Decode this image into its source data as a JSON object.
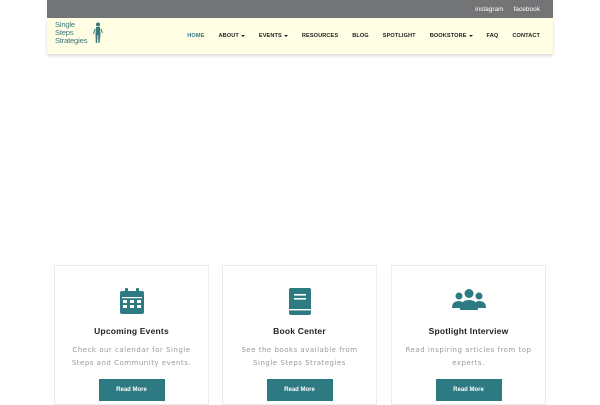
{
  "topbar": {
    "links": [
      "instagram",
      "facebook"
    ]
  },
  "logo": {
    "line1": "Single",
    "line2": "Steps",
    "line3": "Strategies",
    "icon": "walking-figures-icon"
  },
  "nav": {
    "items": [
      {
        "label": "HOME",
        "active": true,
        "dropdown": false
      },
      {
        "label": "ABOUT",
        "active": false,
        "dropdown": true
      },
      {
        "label": "EVENTS",
        "active": false,
        "dropdown": true
      },
      {
        "label": "RESOURCES",
        "active": false,
        "dropdown": false
      },
      {
        "label": "BLOG",
        "active": false,
        "dropdown": false
      },
      {
        "label": "SPOTLIGHT",
        "active": false,
        "dropdown": false
      },
      {
        "label": "BOOKSTORE",
        "active": false,
        "dropdown": true
      },
      {
        "label": "FAQ",
        "active": false,
        "dropdown": false
      },
      {
        "label": "CONTACT",
        "active": false,
        "dropdown": false
      }
    ]
  },
  "cards": [
    {
      "icon": "calendar-icon",
      "title": "Upcoming Events",
      "desc": "Check our calendar for Single Steps and Community events.",
      "button": "Read More"
    },
    {
      "icon": "book-icon",
      "title": "Book Center",
      "desc": "See the books available from Single Steps Strategies",
      "button": "Read More"
    },
    {
      "icon": "users-icon",
      "title": "Spotlight Interview",
      "desc": "Read inspiring articles from top experts.",
      "button": "Read More"
    }
  ],
  "colors": {
    "accent": "#2e7a83",
    "topbar": "#737476",
    "navbar": "#fffde3",
    "logo": "#39797a"
  }
}
